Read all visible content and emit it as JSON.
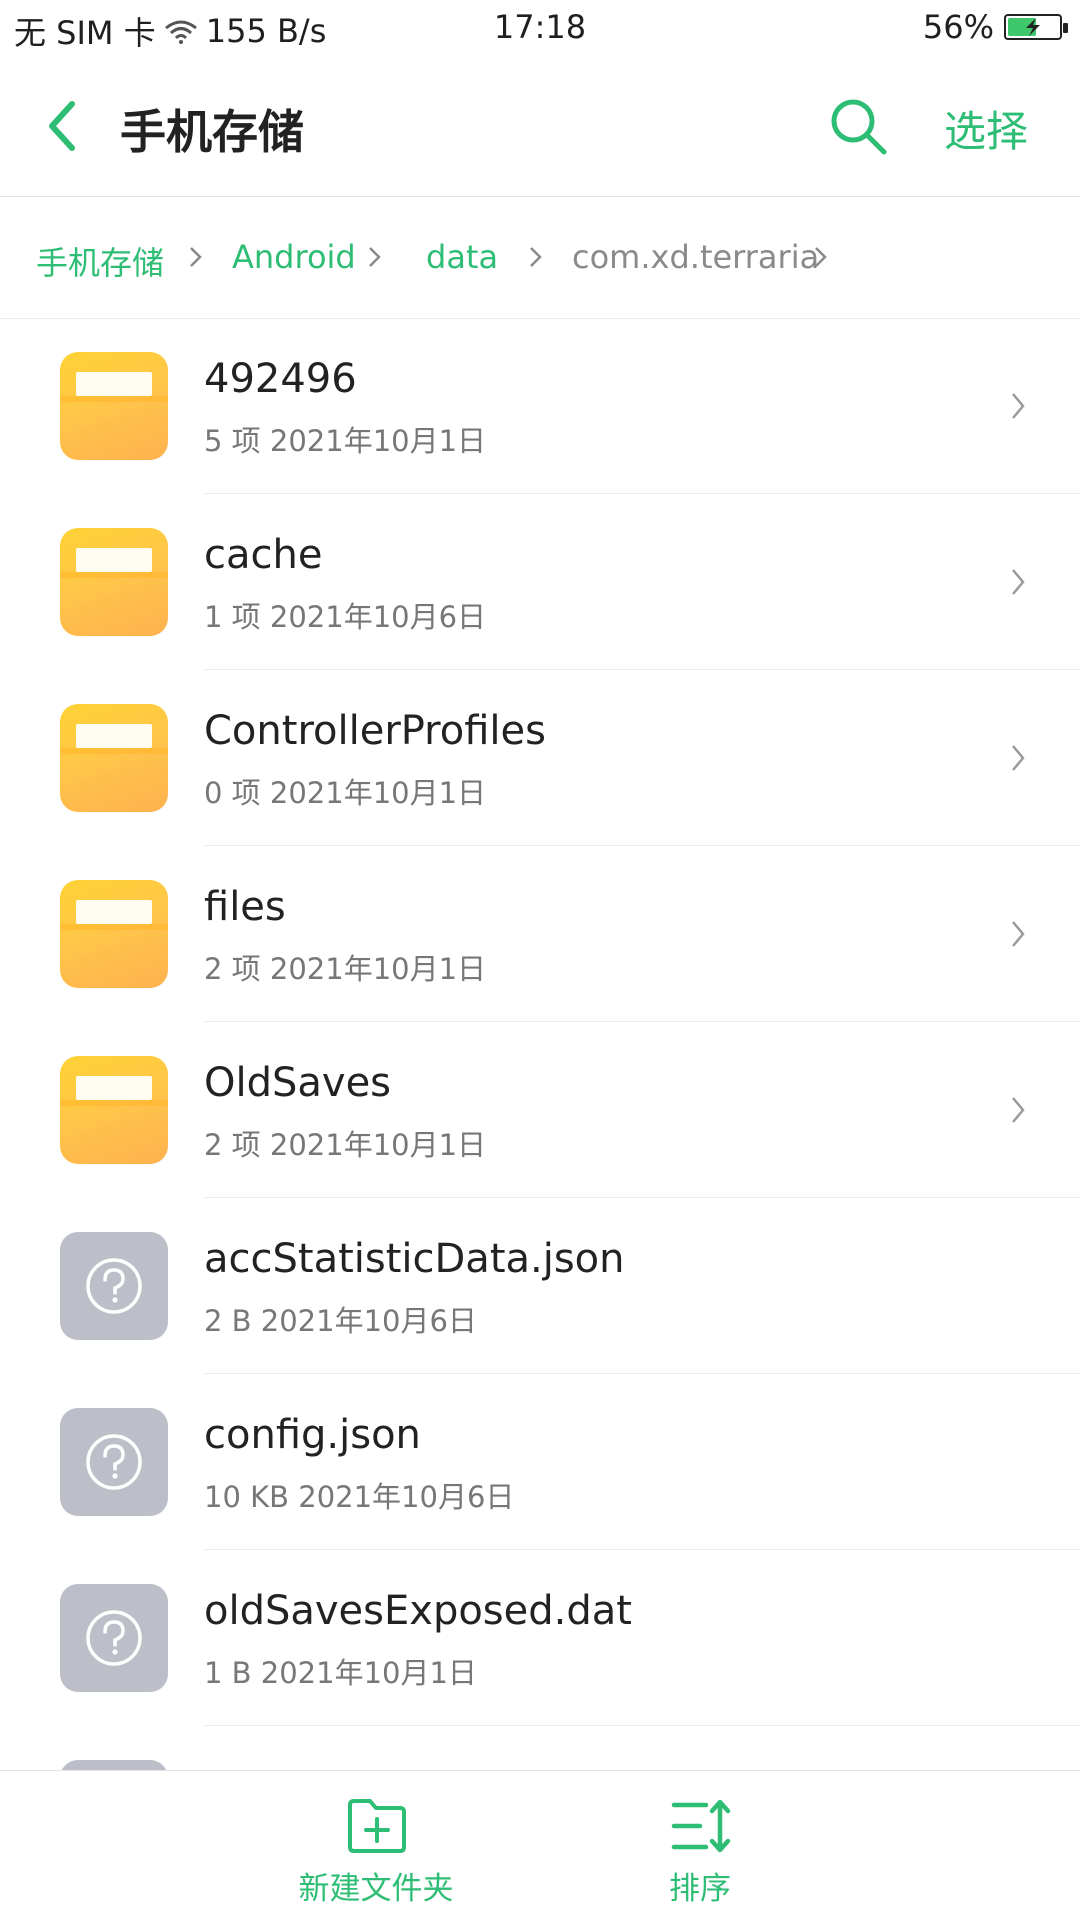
{
  "status_bar": {
    "carrier": "无 SIM 卡",
    "speed": "155 B/s",
    "time": "17:18",
    "battery": "56%",
    "battery_level": 0.56
  },
  "header": {
    "back_icon": "chevron-left-icon",
    "title": "手机存储",
    "search_icon": "search-icon",
    "select_label": "选择"
  },
  "breadcrumb": {
    "items": [
      "手机存储",
      "Android",
      "data",
      "com.xd.terraria"
    ]
  },
  "files": [
    {
      "name": "492496",
      "meta": "5 项  2021年10月1日",
      "type": "folder"
    },
    {
      "name": "cache",
      "meta": "1 项  2021年10月6日",
      "type": "folder"
    },
    {
      "name": "ControllerProfiles",
      "meta": "0 项  2021年10月1日",
      "type": "folder"
    },
    {
      "name": "files",
      "meta": "2 项  2021年10月1日",
      "type": "folder"
    },
    {
      "name": "OldSaves",
      "meta": "2 项  2021年10月1日",
      "type": "folder"
    },
    {
      "name": "accStatisticData.json",
      "meta": "2 B  2021年10月6日",
      "type": "unknown"
    },
    {
      "name": "config.json",
      "meta": "10 KB  2021年10月6日",
      "type": "unknown"
    },
    {
      "name": "oldSavesExposed.dat",
      "meta": "1 B  2021年10月1日",
      "type": "unknown"
    }
  ],
  "bottom_bar": {
    "new_folder_label": "新建文件夹",
    "sort_label": "排序"
  },
  "colors": {
    "accent": "#2ebd74",
    "folder": "#ffc44a",
    "unknown_file": "#bcbfc7"
  }
}
